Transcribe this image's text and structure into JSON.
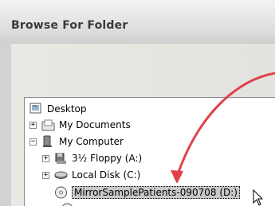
{
  "window": {
    "title": "Browse For Folder"
  },
  "tree": {
    "items": [
      {
        "label": "Desktop",
        "icon": "desktop-icon"
      },
      {
        "label": "My Documents",
        "icon": "documents-folder-icon",
        "expander": "+"
      },
      {
        "label": "My Computer",
        "icon": "computer-icon",
        "expander": "−"
      },
      {
        "label": "3½ Floppy (A:)",
        "icon": "floppy-drive-icon",
        "expander": "+"
      },
      {
        "label": "Local Disk (C:)",
        "icon": "hard-disk-icon",
        "expander": "+"
      },
      {
        "label": "MirrorSamplePatients-090708 (D:)",
        "icon": "cd-drive-icon",
        "selected": true
      }
    ]
  },
  "colors": {
    "arrow": "#e0404a",
    "selection": "#c8c8c8"
  }
}
